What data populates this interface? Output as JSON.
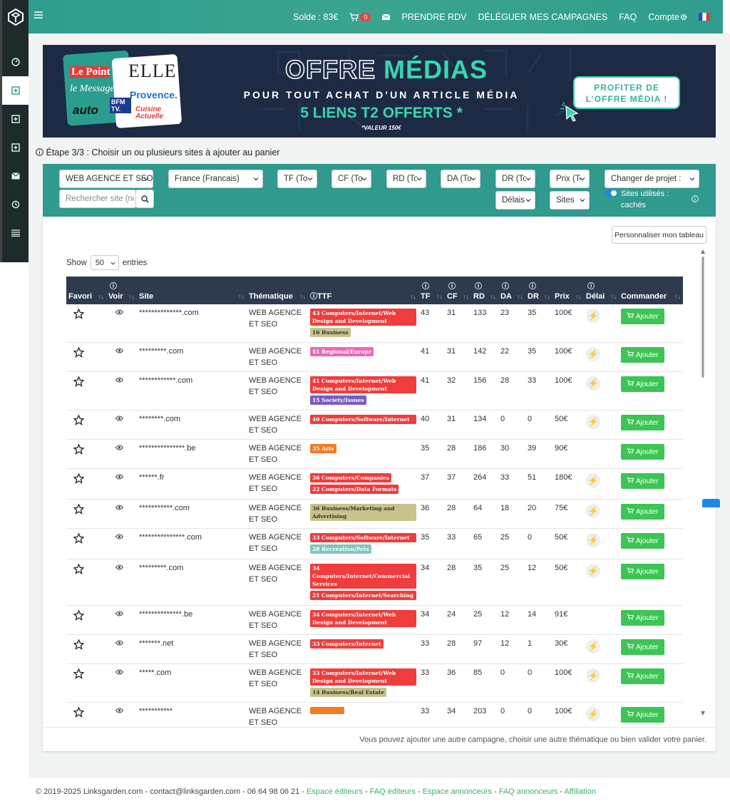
{
  "topbar": {
    "balance": "Solde : 83€",
    "cart_count": "0",
    "nav": [
      "PRENDRE RDV",
      "DÉLÉGUER MES CAMPAGNES",
      "FAQ",
      "Compte"
    ]
  },
  "banner": {
    "title_a": "OFFRE",
    "title_b": "MÉDIAS",
    "subtitle": "POUR TOUT ACHAT D’UN ARTICLE MÉDIA",
    "offer": "5 LIENS T2 OFFERTS *",
    "note": "*VALEUR 150€",
    "cta_line1": "PROFITER DE",
    "cta_line2": "L’OFFRE MÉDIA !",
    "logos": [
      "Le Point",
      "ELLE",
      "le Messager",
      "Provence.",
      "auto",
      "BFM TV.",
      "Cuisine Actuelle"
    ]
  },
  "step_text": "Étape 3/3 : Choisir un ou plusieurs sites à ajouter au panier",
  "filters": {
    "category": "WEB AGENCE ET SEO",
    "country": "France (Francais)",
    "tf": "TF (Tous)",
    "cf": "CF (Tous)",
    "rd": "RD (Tous)",
    "da": "DA (Tous)",
    "dr": "DR (Tous)",
    "price": "Prix (Tous)",
    "project": "Changer de projet :",
    "delay": "Délais",
    "sites": "Sites",
    "search_placeholder": "Rechercher site (nom)",
    "toggle_label": "Sites utilisés : cachés"
  },
  "customize_label": "Personnaliser mon tableau",
  "show": {
    "before": "Show",
    "value": "50",
    "after": "entries"
  },
  "columns": [
    "Favori",
    "Voir",
    "Site",
    "Thématique",
    "TTF",
    "TF",
    "CF",
    "RD",
    "DA",
    "DR",
    "Prix",
    "Délai",
    "Commander"
  ],
  "add_label": "Ajouter",
  "rows": [
    {
      "site": "**************.com",
      "theme": "WEB AGENCE ET SEO",
      "tags": [
        {
          "t": "43 Computers/Internet/Web Design and Development",
          "c": "red"
        },
        {
          "t": "16 Business",
          "c": "olive",
          "inl": true
        }
      ],
      "tf": "43",
      "cf": "31",
      "rd": "133",
      "da": "23",
      "dr": "35",
      "price": "100€",
      "fast": true
    },
    {
      "site": "*********.com",
      "theme": "WEB AGENCE ET SEO",
      "tags": [
        {
          "t": "41 Regional/Europe",
          "c": "pink",
          "inl": true
        }
      ],
      "tf": "41",
      "cf": "31",
      "rd": "142",
      "da": "22",
      "dr": "35",
      "price": "100€",
      "fast": true
    },
    {
      "site": "************.com",
      "theme": "WEB AGENCE ET SEO",
      "tags": [
        {
          "t": "41 Computers/Internet/Web Design and Development",
          "c": "red"
        },
        {
          "t": "15 Society/Issues",
          "c": "purple",
          "inl": true
        }
      ],
      "tf": "41",
      "cf": "32",
      "rd": "156",
      "da": "28",
      "dr": "33",
      "price": "100€",
      "fast": true
    },
    {
      "site": "********.com",
      "theme": "WEB AGENCE ET SEO",
      "tags": [
        {
          "t": "40 Computers/Software/Internet",
          "c": "red"
        }
      ],
      "tf": "40",
      "cf": "31",
      "rd": "134",
      "da": "0",
      "dr": "0",
      "price": "50€",
      "fast": true
    },
    {
      "site": "***************.be",
      "theme": "WEB AGENCE ET SEO",
      "tags": [
        {
          "t": "35 Arts",
          "c": "orange",
          "inl": true
        }
      ],
      "tf": "35",
      "cf": "28",
      "rd": "186",
      "da": "30",
      "dr": "39",
      "price": "90€",
      "fast": false
    },
    {
      "site": "******.fr",
      "theme": "WEB AGENCE ET SEO",
      "tags": [
        {
          "t": "36 Computers/Companies",
          "c": "red",
          "inl": true
        },
        {
          "t": "22 Computers/Data Formats",
          "c": "red",
          "inl": true
        }
      ],
      "tf": "37",
      "cf": "37",
      "rd": "264",
      "da": "33",
      "dr": "51",
      "price": "180€",
      "fast": true
    },
    {
      "site": "***********.com",
      "theme": "WEB AGENCE ET SEO",
      "tags": [
        {
          "t": "36 Business/Marketing and Advertising",
          "c": "olive"
        }
      ],
      "tf": "36",
      "cf": "28",
      "rd": "64",
      "da": "18",
      "dr": "20",
      "price": "75€",
      "fast": true
    },
    {
      "site": "***************.com",
      "theme": "WEB AGENCE ET SEO",
      "tags": [
        {
          "t": "33 Computers/Software/Internet",
          "c": "red"
        },
        {
          "t": "28 Recreation/Pets",
          "c": "teal",
          "inl": true
        }
      ],
      "tf": "35",
      "cf": "33",
      "rd": "65",
      "da": "25",
      "dr": "0",
      "price": "50€",
      "fast": true
    },
    {
      "site": "*********.com",
      "theme": "WEB AGENCE ET SEO",
      "tags": [
        {
          "t": "34 Computers/Internet/Commercial Services",
          "c": "red"
        },
        {
          "t": "21 Computers/Internet/Searching",
          "c": "red"
        }
      ],
      "tf": "34",
      "cf": "28",
      "rd": "35",
      "da": "25",
      "dr": "12",
      "price": "50€",
      "fast": true
    },
    {
      "site": "**************.be",
      "theme": "WEB AGENCE ET SEO",
      "tags": [
        {
          "t": "34 Computers/Internet/Web Design and Development",
          "c": "red"
        }
      ],
      "tf": "34",
      "cf": "24",
      "rd": "25",
      "da": "12",
      "dr": "14",
      "price": "91€",
      "fast": false
    },
    {
      "site": "*******.net",
      "theme": "WEB AGENCE ET SEO",
      "tags": [
        {
          "t": "33 Computers/Internet",
          "c": "red",
          "inl": true
        }
      ],
      "tf": "33",
      "cf": "28",
      "rd": "97",
      "da": "12",
      "dr": "1",
      "price": "30€",
      "fast": true
    },
    {
      "site": "*****.com",
      "theme": "WEB AGENCE ET SEO",
      "tags": [
        {
          "t": "33 Computers/Internet/Web Design and Development",
          "c": "red"
        },
        {
          "t": "14 Business/Real Estate",
          "c": "olive",
          "inl": true
        }
      ],
      "tf": "33",
      "cf": "36",
      "rd": "85",
      "da": "0",
      "dr": "0",
      "price": "100€",
      "fast": true
    },
    {
      "site": "***********",
      "theme": "WEB AGENCE ET SEO",
      "tags": [
        {
          "t": "",
          "c": "orange",
          "inl": true
        }
      ],
      "tf": "33",
      "cf": "34",
      "rd": "203",
      "da": "0",
      "dr": "0",
      "price": "100€",
      "fast": true
    }
  ],
  "footnote": "Vous pouvez ajouter une autre campagne, choisir une autre thématique ou bien valider votre panier.",
  "footer": {
    "copyright": "© 2019-2025 Linksgarden.com - contact@linksgarden.com - 06 64 98 06 21 - ",
    "links": [
      "Espace éditeurs",
      "FAQ éditeurs",
      "Espace annonceurs",
      "FAQ annonceurs",
      "Affiliation"
    ]
  }
}
